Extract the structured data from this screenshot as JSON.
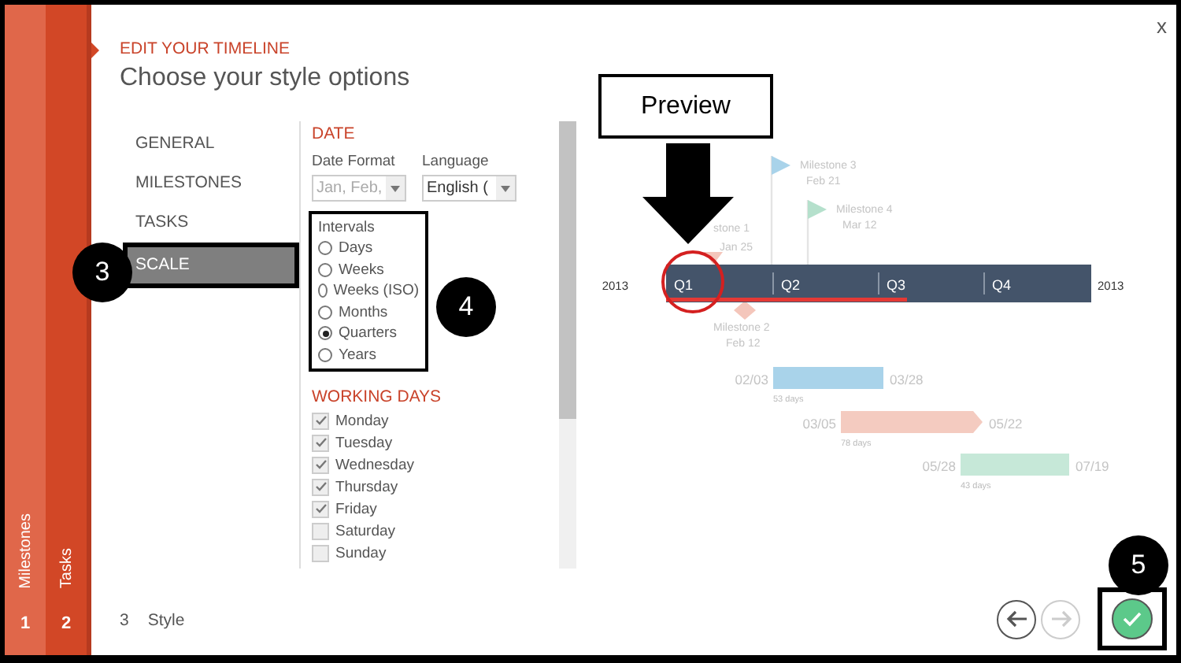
{
  "steps": [
    {
      "number": "1",
      "label": "Milestones"
    },
    {
      "number": "2",
      "label": "Tasks"
    },
    {
      "number": "3",
      "label": "Style"
    }
  ],
  "header": {
    "eyebrow": "EDIT YOUR TIMELINE",
    "title": "Choose your style options",
    "close": "x"
  },
  "nav": [
    {
      "label": "GENERAL",
      "selected": false
    },
    {
      "label": "MILESTONES",
      "selected": false
    },
    {
      "label": "TASKS",
      "selected": false
    },
    {
      "label": "SCALE",
      "selected": true
    }
  ],
  "date": {
    "heading": "DATE",
    "format_label": "Date Format",
    "format_value": "Jan, Feb,",
    "format_disabled": true,
    "language_label": "Language",
    "language_value": "English (",
    "language_disabled": false
  },
  "intervals": {
    "label": "Intervals",
    "options": [
      {
        "label": "Days",
        "selected": false
      },
      {
        "label": "Weeks",
        "selected": false
      },
      {
        "label": "Weeks (ISO)",
        "selected": false
      },
      {
        "label": "Months",
        "selected": false
      },
      {
        "label": "Quarters",
        "selected": true
      },
      {
        "label": "Years",
        "selected": false
      }
    ]
  },
  "working_days": {
    "heading": "WORKING DAYS",
    "days": [
      {
        "label": "Monday",
        "checked": true
      },
      {
        "label": "Tuesday",
        "checked": true
      },
      {
        "label": "Wednesday",
        "checked": true
      },
      {
        "label": "Thursday",
        "checked": true
      },
      {
        "label": "Friday",
        "checked": true
      },
      {
        "label": "Saturday",
        "checked": false
      },
      {
        "label": "Sunday",
        "checked": false
      }
    ]
  },
  "preview": {
    "start_year": "2013",
    "end_year": "2013",
    "quarters": [
      "Q1",
      "Q2",
      "Q3",
      "Q4"
    ],
    "milestones": [
      {
        "kind": "triangle",
        "name": "stone 1",
        "date": "Jan 25",
        "color": "#f4c6bb"
      },
      {
        "kind": "diamond",
        "name": "Milestone 2",
        "date": "Feb 12",
        "color": "#f4c6bb"
      },
      {
        "kind": "flag",
        "name": "Milestone 3",
        "date": "Feb 21",
        "color": "#a9d3ea"
      },
      {
        "kind": "flag",
        "name": "Milestone 4",
        "date": "Mar 12",
        "color": "#b5e0cc"
      }
    ],
    "tasks": [
      {
        "kind": "bar",
        "start": "02/03",
        "end": "03/28",
        "duration": "53 days",
        "color": "#a9d3ea"
      },
      {
        "kind": "arrow",
        "start": "03/05",
        "end": "05/22",
        "duration": "78 days",
        "color": "#f4cbc0"
      },
      {
        "kind": "bar",
        "start": "05/28",
        "end": "07/19",
        "duration": "43 days",
        "color": "#c6e8d8"
      }
    ]
  },
  "annotations": {
    "badges": [
      "3",
      "4",
      "5"
    ],
    "preview_label": "Preview"
  },
  "nav_buttons": [
    {
      "kind": "back",
      "disabled": false
    },
    {
      "kind": "forward",
      "disabled": true
    },
    {
      "kind": "finish",
      "disabled": false
    }
  ]
}
